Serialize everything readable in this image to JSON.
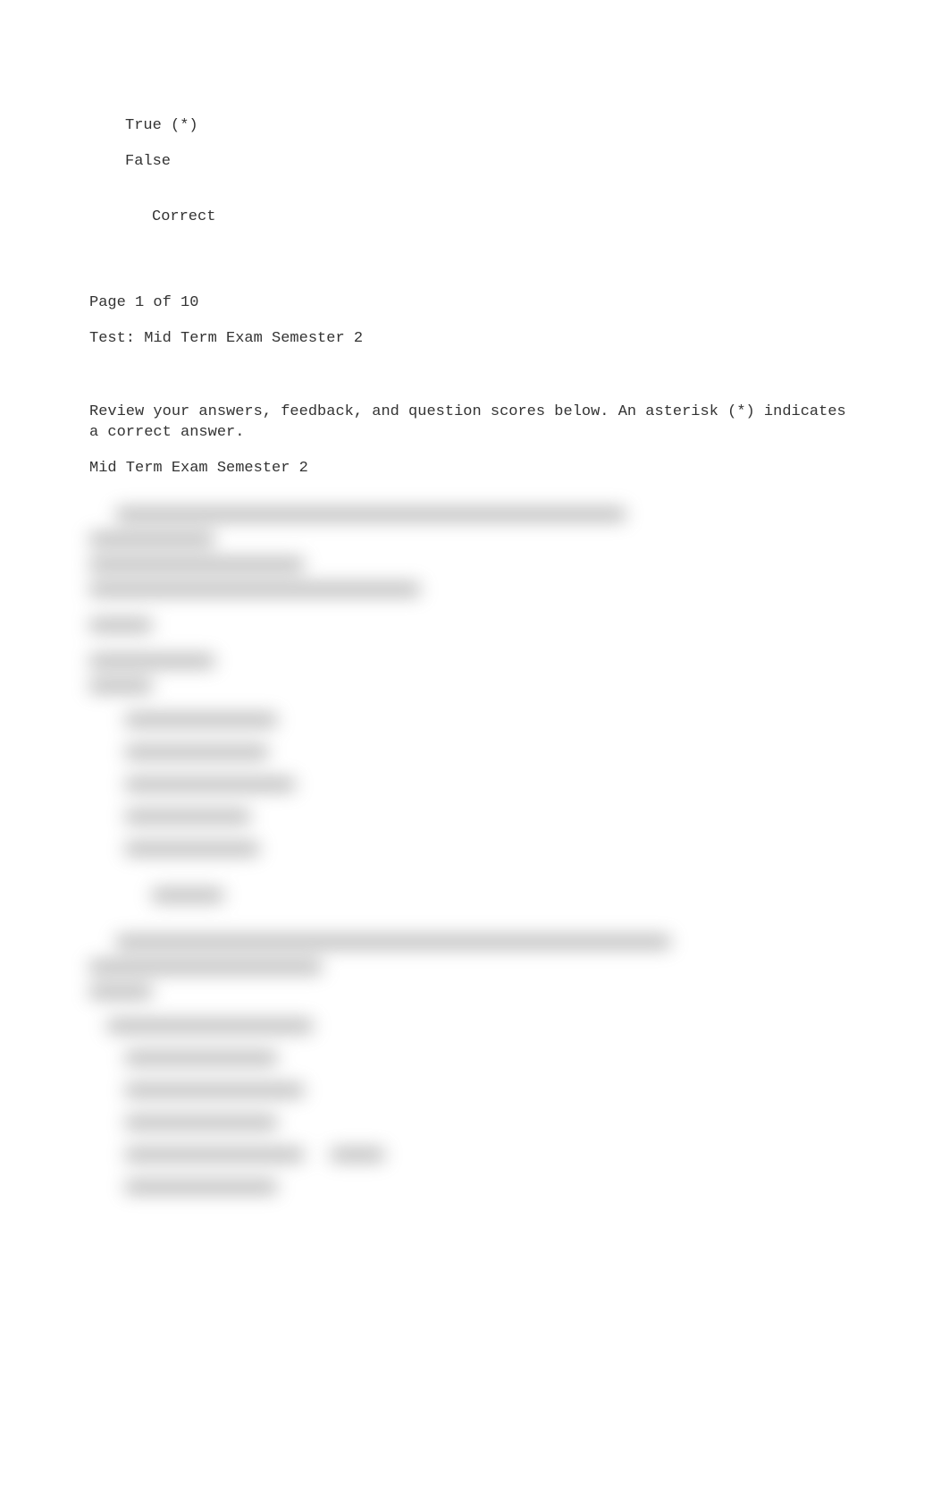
{
  "answers": {
    "true_marked": "True (*)",
    "false_plain": "False",
    "correct": "Correct"
  },
  "pager": "Page 1 of 10",
  "test_title": "Test: Mid Term Exam Semester 2",
  "review_text": "Review your answers, feedback, and question scores below. An asterisk (*) indicates a correct answer.",
  "section_header": " Mid Term Exam Semester 2"
}
